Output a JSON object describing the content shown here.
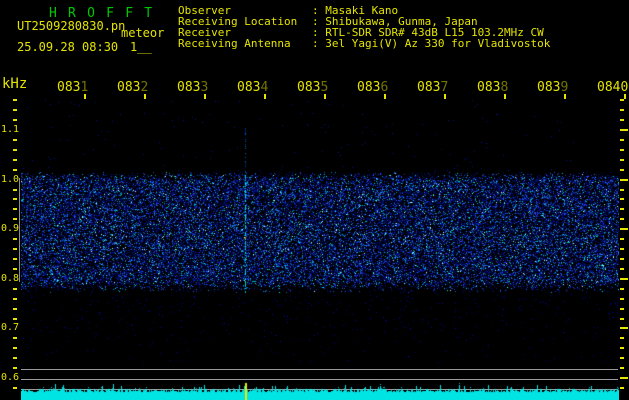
{
  "app": {
    "title": "H R O F F T"
  },
  "header": {
    "filename": "UT2509280830.pn",
    "mode_label": "meteor",
    "datetime": "25.09.28 08:30",
    "counter": "1__",
    "separator": ": ",
    "info_rows": [
      {
        "label": "Observer",
        "value": "Masaki Kano"
      },
      {
        "label": "Receiving Location",
        "value": "Shibukawa, Gunma, Japan"
      },
      {
        "label": "Receiver",
        "value": "RTL-SDR SDR# 43dB L15 103.2MHz CW"
      },
      {
        "label": "Receiving Antenna",
        "value": "3el Yagi(V) Az 330 for Vladivostok"
      }
    ]
  },
  "chart_data": {
    "type": "heatmap",
    "description": "Radio meteor echo spectrogram with signal-level strip below",
    "x_tick_labels": [
      "0831",
      "0832",
      "0833",
      "0834",
      "0835",
      "0836",
      "0837",
      "0838",
      "0839",
      "0840"
    ],
    "y_unit": "kHz",
    "y_tick_labels": [
      "1.1",
      "1.0",
      "0.9",
      "0.8",
      "0.7",
      "0.6"
    ],
    "y_range_khz": [
      0.58,
      1.17
    ],
    "noise_band_khz": [
      0.8,
      1.0
    ],
    "echo": {
      "approx_minute": 33.87,
      "freq_extent_khz": [
        0.77,
        1.1
      ],
      "has_bottom_marker": true
    },
    "level_strip": {
      "style": "area",
      "color": "#00e4e4"
    },
    "legend": "none",
    "grid": "reference lines at bottom strip only"
  },
  "colors": {
    "background": "#000000",
    "title_green": "#00c800",
    "text_yellow": "#e4e400",
    "noise_blue": "#0000c8",
    "echo_cyan": "#00ffff",
    "echo_spark_orange": "#ff8200",
    "level_cyan": "#00e4e4",
    "grid_gray": "#9a9a9a"
  }
}
